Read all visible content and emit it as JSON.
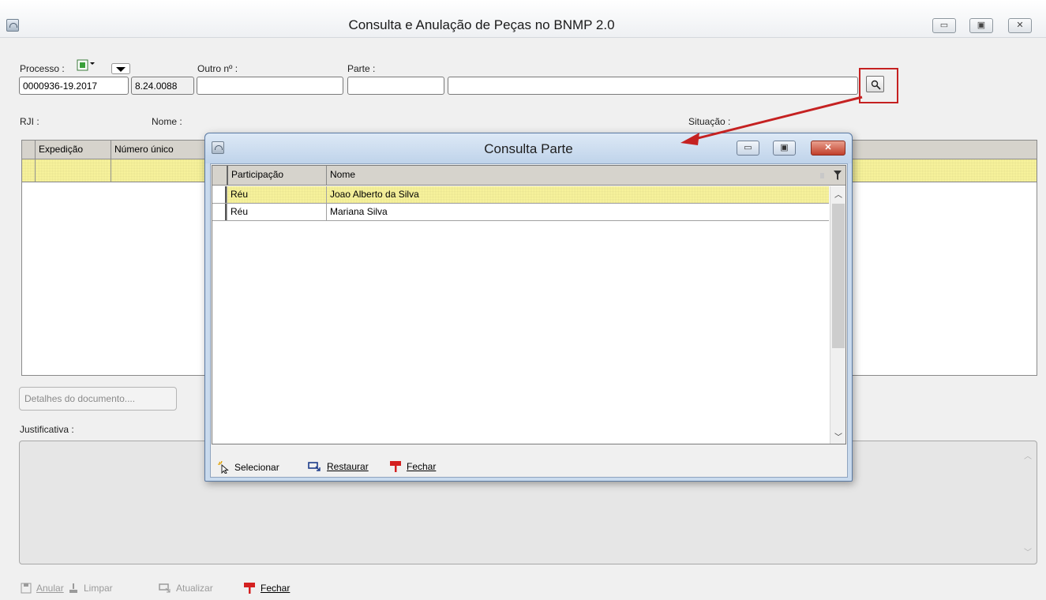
{
  "window": {
    "title": "Consulta e Anulação de Peças no BNMP 2.0"
  },
  "form": {
    "processo_label": "Processo :",
    "processo_numero": "0000936-19.2017",
    "processo_complemento": "8.24.0088",
    "outro_label": "Outro nº :",
    "outro_value": "",
    "parte_label": "Parte :",
    "parte_code": "",
    "parte_name": "",
    "rji_label": "RJI :",
    "nome_label": "Nome :",
    "situacao_label": "Situação :"
  },
  "main_grid": {
    "columns": [
      "Expedição",
      "Número único"
    ]
  },
  "detalhes_button": "Detalhes do documento....",
  "justificativa_label": "Justificativa :",
  "bottom_toolbar": {
    "anular": "Anular",
    "limpar": "Limpar",
    "atualizar": "Atualizar",
    "fechar": "Fechar"
  },
  "dialog": {
    "title": "Consulta Parte",
    "columns": [
      "Participação",
      "Nome"
    ],
    "rows": [
      {
        "participacao": "Réu",
        "nome": "Joao Alberto da Silva"
      },
      {
        "participacao": "Réu",
        "nome": "Mariana Silva"
      }
    ],
    "toolbar": {
      "selecionar": "Selecionar",
      "restaurar": "Restaurar",
      "fechar": "Fechar"
    }
  },
  "colors": {
    "selected_row": "#fffaa0",
    "header_bg": "#d6d3cc",
    "highlight": "#c52121"
  }
}
